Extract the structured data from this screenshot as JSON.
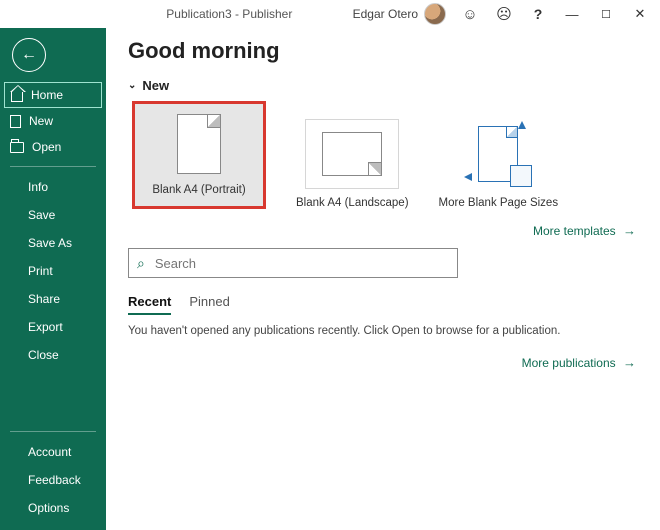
{
  "titlebar": {
    "document_title": "Publication3  -  Publisher",
    "user_name": "Edgar Otero"
  },
  "sidebar": {
    "home": "Home",
    "new": "New",
    "open": "Open",
    "info": "Info",
    "save": "Save",
    "save_as": "Save As",
    "print": "Print",
    "share": "Share",
    "export": "Export",
    "close": "Close",
    "account": "Account",
    "feedback": "Feedback",
    "options": "Options"
  },
  "main": {
    "greeting": "Good morning",
    "new_section": "New",
    "templates": {
      "blank_portrait": "Blank A4 (Portrait)",
      "blank_landscape": "Blank A4 (Landscape)",
      "more_sizes": "More Blank Page Sizes"
    },
    "more_templates": "More templates",
    "search_placeholder": "Search",
    "tabs": {
      "recent": "Recent",
      "pinned": "Pinned"
    },
    "empty_recent": "You haven't opened any publications recently. Click Open to browse for a publication.",
    "more_publications": "More publications"
  }
}
